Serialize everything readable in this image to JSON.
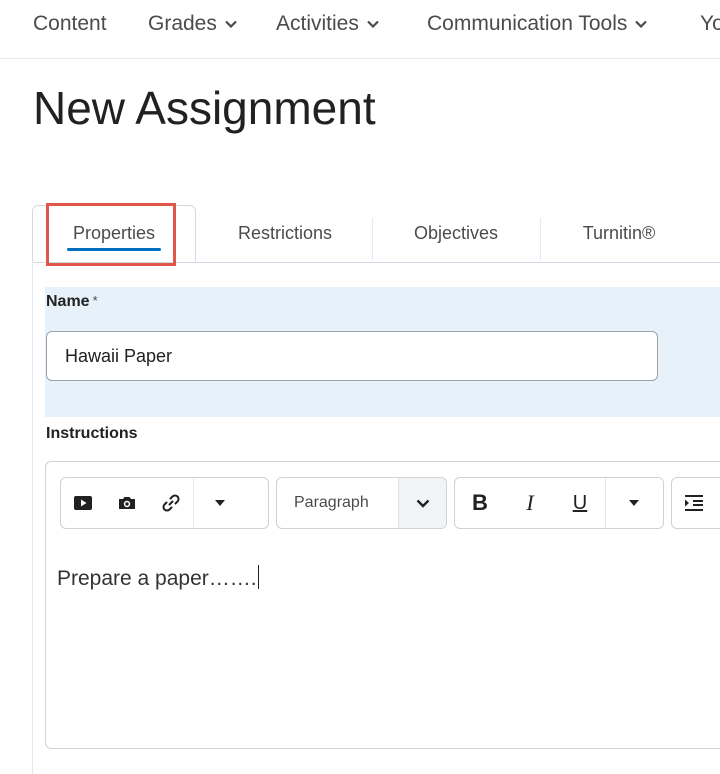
{
  "nav": {
    "items": [
      {
        "label": "Content",
        "dropdown": false
      },
      {
        "label": "Grades",
        "dropdown": true
      },
      {
        "label": "Activities",
        "dropdown": true
      },
      {
        "label": "Communication Tools",
        "dropdown": true
      },
      {
        "label": "Yo",
        "dropdown": false
      }
    ]
  },
  "page": {
    "title": "New Assignment"
  },
  "tabs": [
    {
      "label": "Properties",
      "active": true
    },
    {
      "label": "Restrictions",
      "active": false
    },
    {
      "label": "Objectives",
      "active": false
    },
    {
      "label": "Turnitin®",
      "active": false
    }
  ],
  "form": {
    "name_label": "Name",
    "name_required_mark": "*",
    "name_value": "Hawaii Paper",
    "instructions_label": "Instructions"
  },
  "editor": {
    "toolbar": {
      "insert_media_icon": "video-play-icon",
      "insert_image_icon": "camera-icon",
      "insert_link_icon": "link-icon",
      "more_insert_icon": "caret-down-icon",
      "format_select_value": "Paragraph",
      "bold_label": "B",
      "italic_label": "I",
      "underline_label": "U",
      "more_format_icon": "caret-down-icon",
      "indent_icon": "indent-icon"
    },
    "content": "Prepare a paper……."
  },
  "colors": {
    "accent": "#006fbf",
    "highlight": "#e0574a",
    "name_section_bg": "#e6f1f9"
  }
}
